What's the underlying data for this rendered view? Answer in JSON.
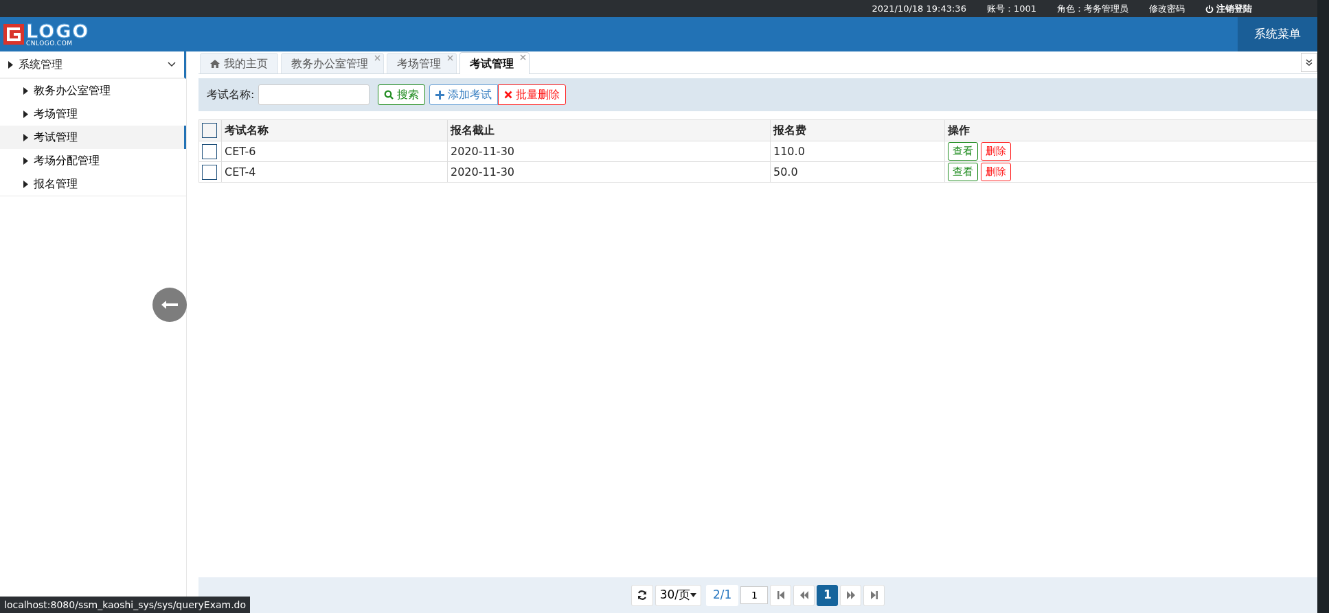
{
  "top_bar": {
    "datetime": "2021/10/18 19:43:36",
    "account": "账号：1001",
    "role": "角色：考务管理员",
    "change_password": "修改密码",
    "logout": "注销登陆"
  },
  "header": {
    "logo_text": "LOGO",
    "logo_subtext": "CNLOGO.COM",
    "menu_button": "系统菜单"
  },
  "sidebar": {
    "groups": [
      {
        "label": "系统管理",
        "expanded": true,
        "children": [
          {
            "label": "教务办公室管理",
            "selected": false
          },
          {
            "label": "考场管理",
            "selected": false
          },
          {
            "label": "考试管理",
            "selected": true
          },
          {
            "label": "考场分配管理",
            "selected": false
          },
          {
            "label": "报名管理",
            "selected": false
          }
        ]
      }
    ]
  },
  "tabs": [
    {
      "label": "我的主页",
      "kind": "home",
      "closable": false,
      "selected": false
    },
    {
      "label": "教务办公室管理",
      "kind": "page",
      "closable": true,
      "selected": false
    },
    {
      "label": "考场管理",
      "kind": "page",
      "closable": true,
      "selected": false
    },
    {
      "label": "考试管理",
      "kind": "page",
      "closable": true,
      "selected": true
    }
  ],
  "toolbar": {
    "search_label": "考试名称:",
    "search_button": "搜索",
    "add_button": "添加考试",
    "batch_delete_button": "批量删除"
  },
  "table": {
    "select_all_checked": false,
    "columns": [
      "考试名称",
      "报名截止",
      "报名费",
      "操作"
    ],
    "rows": [
      {
        "checked": false,
        "cells": [
          "CET-6",
          "2020-11-30",
          "110.0"
        ],
        "actions": [
          "查看",
          "删除"
        ]
      },
      {
        "checked": false,
        "cells": [
          "CET-4",
          "2020-11-30",
          "50.0"
        ],
        "actions": [
          "查看",
          "删除"
        ]
      }
    ]
  },
  "pager": {
    "page_size": "30/页",
    "page_info": "2/1",
    "page_input": "1",
    "pages": [
      {
        "label": "1",
        "selected": true
      }
    ]
  },
  "status_url": "localhost:8080/ssm_kaoshi_sys/sys/queryExam.do"
}
